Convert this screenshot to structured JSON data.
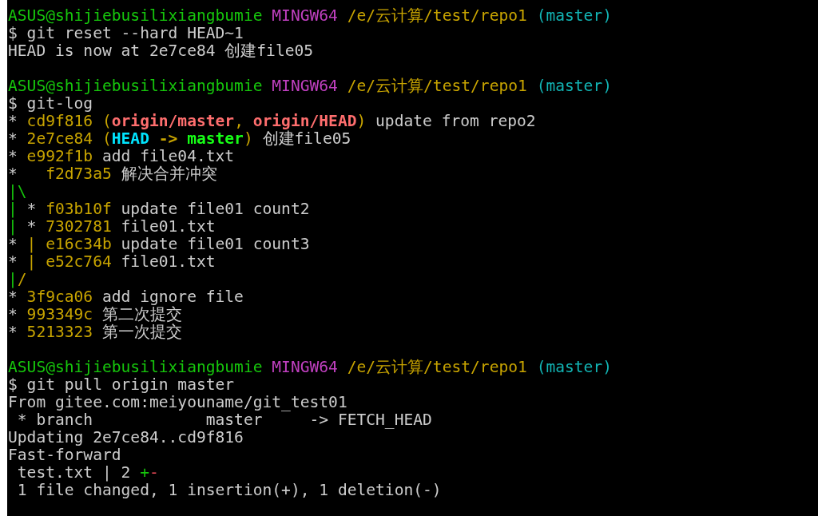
{
  "terminal": {
    "lines": [
      {
        "segments": [
          {
            "kind": "prompt",
            "text": "ASUS@shijiebusilixiangbumie",
            "color": "#16c60c"
          },
          {
            "kind": "prompt",
            "text": " MINGW64",
            "color": "#c040c0"
          },
          {
            "kind": "prompt",
            "text": " /e/云计算/test/repo1",
            "color": "#c8a400"
          },
          {
            "kind": "prompt",
            "text": " (master)",
            "color": "#12b4b4"
          }
        ]
      },
      {
        "segments": [
          {
            "kind": "command",
            "text": "$ git reset --hard HEAD~1",
            "color": "#cccccc"
          }
        ]
      },
      {
        "segments": [
          {
            "kind": "output",
            "text": "HEAD is now at 2e7ce84 创建file05",
            "color": "#cccccc"
          }
        ]
      },
      {
        "kind": "blank"
      },
      {
        "segments": [
          {
            "kind": "prompt",
            "text": "ASUS@shijiebusilixiangbumie",
            "color": "#16c60c"
          },
          {
            "kind": "prompt",
            "text": " MINGW64",
            "color": "#c040c0"
          },
          {
            "kind": "prompt",
            "text": " /e/云计算/test/repo1",
            "color": "#c8a400"
          },
          {
            "kind": "prompt",
            "text": " (master)",
            "color": "#12b4b4"
          }
        ]
      },
      {
        "segments": [
          {
            "kind": "command",
            "text": "$ git-log",
            "color": "#cccccc"
          }
        ]
      },
      {
        "segments": [
          {
            "kind": "graph",
            "text": "*",
            "color": "#cccccc"
          },
          {
            "kind": "hash",
            "text": " cd9f816",
            "color": "#c8a400"
          },
          {
            "kind": "punct",
            "text": " (",
            "color": "#c8a400"
          },
          {
            "kind": "ref",
            "text": "origin/master",
            "color": "#ff6e6e"
          },
          {
            "kind": "punct",
            "text": ", ",
            "color": "#c8a400"
          },
          {
            "kind": "ref",
            "text": "origin/HEAD",
            "color": "#ff6e6e"
          },
          {
            "kind": "punct",
            "text": ")",
            "color": "#c8a400"
          },
          {
            "kind": "message",
            "text": " update from repo2",
            "color": "#cccccc"
          }
        ]
      },
      {
        "segments": [
          {
            "kind": "graph",
            "text": "*",
            "color": "#cccccc"
          },
          {
            "kind": "hash",
            "text": " 2e7ce84",
            "color": "#c8a400"
          },
          {
            "kind": "punct",
            "text": " (",
            "color": "#c8a400"
          },
          {
            "kind": "ref",
            "text": "HEAD",
            "color": "#00e5ff"
          },
          {
            "kind": "ref",
            "text": " -> ",
            "color": "#c8a400"
          },
          {
            "kind": "ref",
            "text": "master",
            "color": "#16ff16"
          },
          {
            "kind": "punct",
            "text": ")",
            "color": "#c8a400"
          },
          {
            "kind": "message",
            "text": " 创建file05",
            "color": "#cccccc"
          }
        ]
      },
      {
        "segments": [
          {
            "kind": "graph",
            "text": "*",
            "color": "#cccccc"
          },
          {
            "kind": "hash",
            "text": " e992f1b",
            "color": "#c8a400"
          },
          {
            "kind": "message",
            "text": " add file04.txt",
            "color": "#cccccc"
          }
        ]
      },
      {
        "segments": [
          {
            "kind": "graph",
            "text": "*",
            "color": "#cccccc"
          },
          {
            "kind": "hash",
            "text": "   f2d73a5",
            "color": "#c8a400"
          },
          {
            "kind": "message",
            "text": " 解决合并冲突",
            "color": "#cccccc"
          }
        ]
      },
      {
        "segments": [
          {
            "kind": "graph",
            "text": "|\\",
            "color": "#16c60c"
          }
        ]
      },
      {
        "segments": [
          {
            "kind": "graph",
            "text": "|",
            "color": "#16c60c"
          },
          {
            "kind": "graph",
            "text": " *",
            "color": "#cccccc"
          },
          {
            "kind": "hash",
            "text": " f03b10f",
            "color": "#c8a400"
          },
          {
            "kind": "message",
            "text": " update file01 count2",
            "color": "#cccccc"
          }
        ]
      },
      {
        "segments": [
          {
            "kind": "graph",
            "text": "|",
            "color": "#16c60c"
          },
          {
            "kind": "graph",
            "text": " *",
            "color": "#cccccc"
          },
          {
            "kind": "hash",
            "text": " 7302781",
            "color": "#c8a400"
          },
          {
            "kind": "message",
            "text": " file01.txt",
            "color": "#cccccc"
          }
        ]
      },
      {
        "segments": [
          {
            "kind": "graph",
            "text": "*",
            "color": "#cccccc"
          },
          {
            "kind": "graph",
            "text": " |",
            "color": "#c8a400"
          },
          {
            "kind": "hash",
            "text": " e16c34b",
            "color": "#c8a400"
          },
          {
            "kind": "message",
            "text": " update file01 count3",
            "color": "#cccccc"
          }
        ]
      },
      {
        "segments": [
          {
            "kind": "graph",
            "text": "*",
            "color": "#cccccc"
          },
          {
            "kind": "graph",
            "text": " |",
            "color": "#c8a400"
          },
          {
            "kind": "hash",
            "text": " e52c764",
            "color": "#c8a400"
          },
          {
            "kind": "message",
            "text": " file01.txt",
            "color": "#cccccc"
          }
        ]
      },
      {
        "segments": [
          {
            "kind": "graph",
            "text": "|",
            "color": "#16c60c"
          },
          {
            "kind": "graph",
            "text": "/",
            "color": "#c8a400"
          }
        ]
      },
      {
        "segments": [
          {
            "kind": "graph",
            "text": "*",
            "color": "#cccccc"
          },
          {
            "kind": "hash",
            "text": " 3f9ca06",
            "color": "#c8a400"
          },
          {
            "kind": "message",
            "text": " add ignore file",
            "color": "#cccccc"
          }
        ]
      },
      {
        "segments": [
          {
            "kind": "graph",
            "text": "*",
            "color": "#cccccc"
          },
          {
            "kind": "hash",
            "text": " 993349c",
            "color": "#c8a400"
          },
          {
            "kind": "message",
            "text": " 第二次提交",
            "color": "#cccccc"
          }
        ]
      },
      {
        "segments": [
          {
            "kind": "graph",
            "text": "*",
            "color": "#cccccc"
          },
          {
            "kind": "hash",
            "text": " 5213323",
            "color": "#c8a400"
          },
          {
            "kind": "message",
            "text": " 第一次提交",
            "color": "#cccccc"
          }
        ]
      },
      {
        "kind": "blank"
      },
      {
        "segments": [
          {
            "kind": "prompt",
            "text": "ASUS@shijiebusilixiangbumie",
            "color": "#16c60c"
          },
          {
            "kind": "prompt",
            "text": " MINGW64",
            "color": "#c040c0"
          },
          {
            "kind": "prompt",
            "text": " /e/云计算/test/repo1",
            "color": "#c8a400"
          },
          {
            "kind": "prompt",
            "text": " (master)",
            "color": "#12b4b4"
          }
        ]
      },
      {
        "segments": [
          {
            "kind": "command",
            "text": "$ git pull origin master",
            "color": "#cccccc"
          }
        ]
      },
      {
        "segments": [
          {
            "kind": "output",
            "text": "From gitee.com:meiyouname/git_test01",
            "color": "#cccccc"
          }
        ]
      },
      {
        "segments": [
          {
            "kind": "output",
            "text": " * branch            master     -> FETCH_HEAD",
            "color": "#cccccc"
          }
        ]
      },
      {
        "segments": [
          {
            "kind": "output",
            "text": "Updating 2e7ce84..cd9f816",
            "color": "#cccccc"
          }
        ]
      },
      {
        "segments": [
          {
            "kind": "output",
            "text": "Fast-forward",
            "color": "#cccccc"
          }
        ]
      },
      {
        "segments": [
          {
            "kind": "output",
            "text": " test.txt | 2 ",
            "color": "#cccccc"
          },
          {
            "kind": "diff",
            "text": "+",
            "color": "#16c60c"
          },
          {
            "kind": "diff",
            "text": "-",
            "color": "#e74856"
          }
        ]
      },
      {
        "segments": [
          {
            "kind": "output",
            "text": " 1 file changed, 1 insertion(+), 1 deletion(-)",
            "color": "#cccccc"
          }
        ]
      }
    ]
  }
}
